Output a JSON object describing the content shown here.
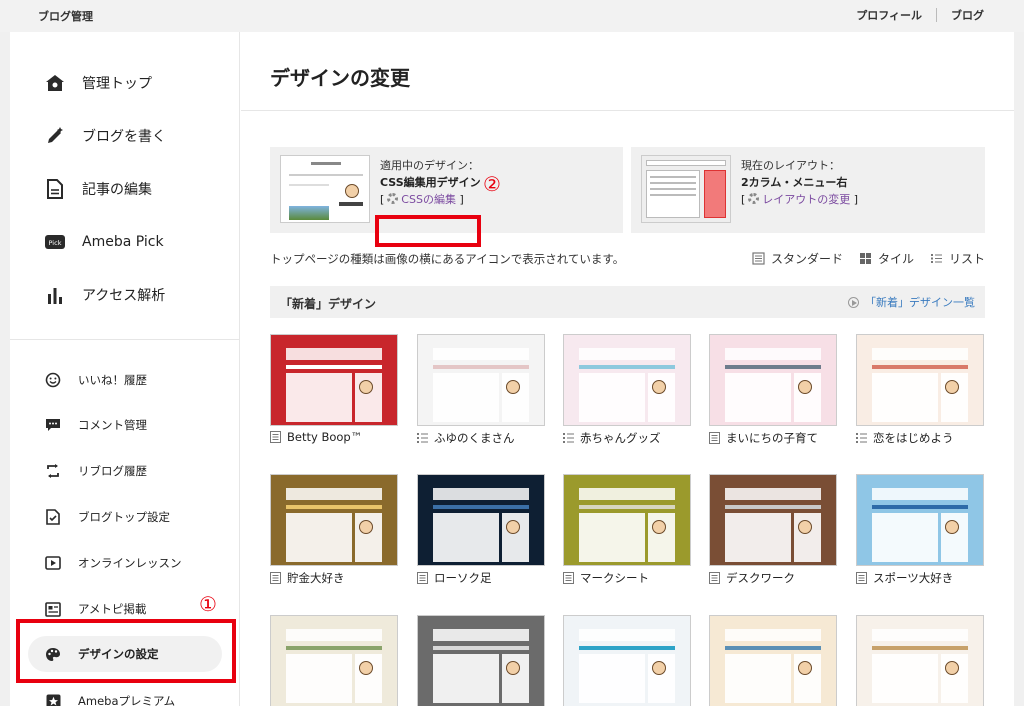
{
  "topbar": {
    "title": "ブログ管理",
    "profile": "プロフィール",
    "blog": "ブログ"
  },
  "sidebar": {
    "main_items": [
      {
        "label": "管理トップ",
        "icon": "home-icon"
      },
      {
        "label": "ブログを書く",
        "icon": "pen-sparkle-icon"
      },
      {
        "label": "記事の編集",
        "icon": "document-icon"
      },
      {
        "label": "Ameba Pick",
        "icon": "pick-badge-icon"
      },
      {
        "label": "アクセス解析",
        "icon": "bar-chart-icon"
      }
    ],
    "sub_items": [
      {
        "label": "いいね！履歴",
        "icon": "smile-icon"
      },
      {
        "label": "コメント管理",
        "icon": "comment-icon"
      },
      {
        "label": "リブログ履歴",
        "icon": "reblog-icon"
      },
      {
        "label": "ブログトップ設定",
        "icon": "settings-doc-icon"
      },
      {
        "label": "オンラインレッスン",
        "icon": "video-icon"
      },
      {
        "label": "アメトピ掲載",
        "icon": "news-icon"
      },
      {
        "label": "デザインの設定",
        "icon": "palette-icon"
      },
      {
        "label": "Amebaプレミアム",
        "icon": "star-badge-icon"
      }
    ],
    "annotation_1": "①"
  },
  "main": {
    "title": "デザインの変更",
    "current_design": {
      "label": "適用中のデザイン：",
      "name": "CSS編集用デザイン",
      "link": "CSSの編集",
      "bracket_open": "[",
      "bracket_close": "]"
    },
    "current_layout": {
      "label": "現在のレイアウト：",
      "name": "2カラム・メニュー右",
      "link": "レイアウトの変更",
      "bracket_open": "[",
      "bracket_close": "]"
    },
    "annotation_2": "②",
    "note": "トップページの種類は画像の横にあるアイコンで表示されています。",
    "views": [
      {
        "label": "スタンダード",
        "icon": "standard-icon"
      },
      {
        "label": "タイル",
        "icon": "tile-icon"
      },
      {
        "label": "リスト",
        "icon": "list-icon"
      }
    ],
    "section": {
      "label": "「新着」デザイン",
      "more": "「新着」デザイン一覧"
    },
    "designs": [
      {
        "name": "Betty Boop™",
        "type": "standard",
        "bg": "#c8262c",
        "accent": "#ffffff"
      },
      {
        "name": "ふゆのくまさん",
        "type": "list",
        "bg": "#f4f4f4",
        "accent": "#e4c6c6"
      },
      {
        "name": "赤ちゃんグッズ",
        "type": "list",
        "bg": "#f7e9ef",
        "accent": "#8ec9de"
      },
      {
        "name": "まいにちの子育て",
        "type": "standard",
        "bg": "#f7dfe6",
        "accent": "#6e7c8c"
      },
      {
        "name": "恋をはじめよう",
        "type": "list",
        "bg": "#f9ede4",
        "accent": "#d97a6a"
      },
      {
        "name": "貯金大好き",
        "type": "standard",
        "bg": "#8a6a2c",
        "accent": "#e9c46a"
      },
      {
        "name": "ローソク足",
        "type": "standard",
        "bg": "#0e1f33",
        "accent": "#3b6fa6"
      },
      {
        "name": "マークシート",
        "type": "standard",
        "bg": "#9b9a2c",
        "accent": "#d7d6c0"
      },
      {
        "name": "デスクワーク",
        "type": "standard",
        "bg": "#7a4e35",
        "accent": "#c9c9c9"
      },
      {
        "name": "スポーツ大好き",
        "type": "standard",
        "bg": "#8fc6e6",
        "accent": "#2c6aa8"
      },
      {
        "name": "",
        "type": "standard",
        "bg": "#efeadb",
        "accent": "#8aa36a"
      },
      {
        "name": "",
        "type": "standard",
        "bg": "#6b6b6b",
        "accent": "#d8d8d8"
      },
      {
        "name": "",
        "type": "standard",
        "bg": "#f0f4f7",
        "accent": "#2da3c7"
      },
      {
        "name": "",
        "type": "standard",
        "bg": "#f6e9d4",
        "accent": "#5a8fb5"
      },
      {
        "name": "",
        "type": "standard",
        "bg": "#f7f1ea",
        "accent": "#c7a16a"
      }
    ]
  },
  "colors": {
    "annotation": "#e8000f",
    "link": "#7b4aa0",
    "more_link": "#3a7bbf"
  }
}
